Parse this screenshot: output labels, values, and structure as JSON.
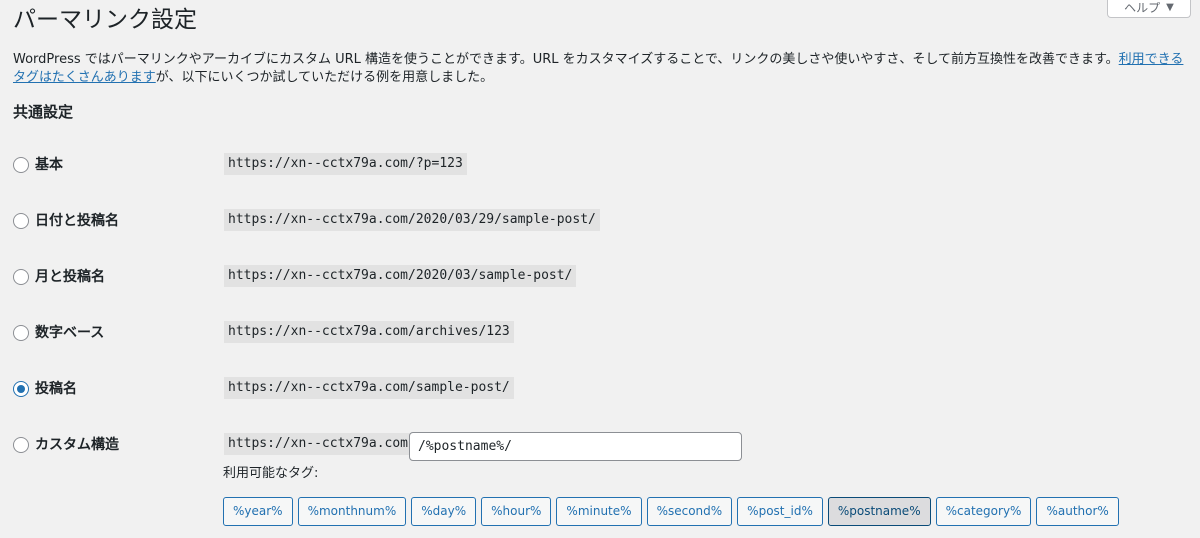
{
  "help": {
    "label": "ヘルプ",
    "arrow": "▼"
  },
  "page": {
    "title": "パーマリンク設定"
  },
  "intro": {
    "text": "WordPress ではパーマリンクやアーカイブにカスタム URL 構造を使うことができます。URL をカスタマイズすることで、リンクの美しさや使いやすさ、そして前方互換性を改善できます。",
    "link": "利用できるタグはたくさんあります",
    "text_after": "が、以下にいくつか試していただける例を用意しました。"
  },
  "section": {
    "title": "共通設定"
  },
  "options": [
    {
      "label": "基本",
      "url": "https://xn--cctx79a.com/?p=123",
      "checked": false
    },
    {
      "label": "日付と投稿名",
      "url": "https://xn--cctx79a.com/2020/03/29/sample-post/",
      "checked": false
    },
    {
      "label": "月と投稿名",
      "url": "https://xn--cctx79a.com/2020/03/sample-post/",
      "checked": false
    },
    {
      "label": "数字ベース",
      "url": "https://xn--cctx79a.com/archives/123",
      "checked": false
    },
    {
      "label": "投稿名",
      "url": "https://xn--cctx79a.com/sample-post/",
      "checked": true
    },
    {
      "label": "カスタム構造",
      "url": "https://xn--cctx79a.com",
      "checked": false
    }
  ],
  "custom": {
    "value": "/%postname%/",
    "available_tags_label": "利用可能なタグ:",
    "tags": [
      "%year%",
      "%monthnum%",
      "%day%",
      "%hour%",
      "%minute%",
      "%second%",
      "%post_id%",
      "%postname%",
      "%category%",
      "%author%"
    ],
    "active_tag": "%postname%"
  },
  "colors": {
    "accent": "#2271b1",
    "background": "#f1f1f1",
    "code_bg": "#e2e2e2"
  }
}
